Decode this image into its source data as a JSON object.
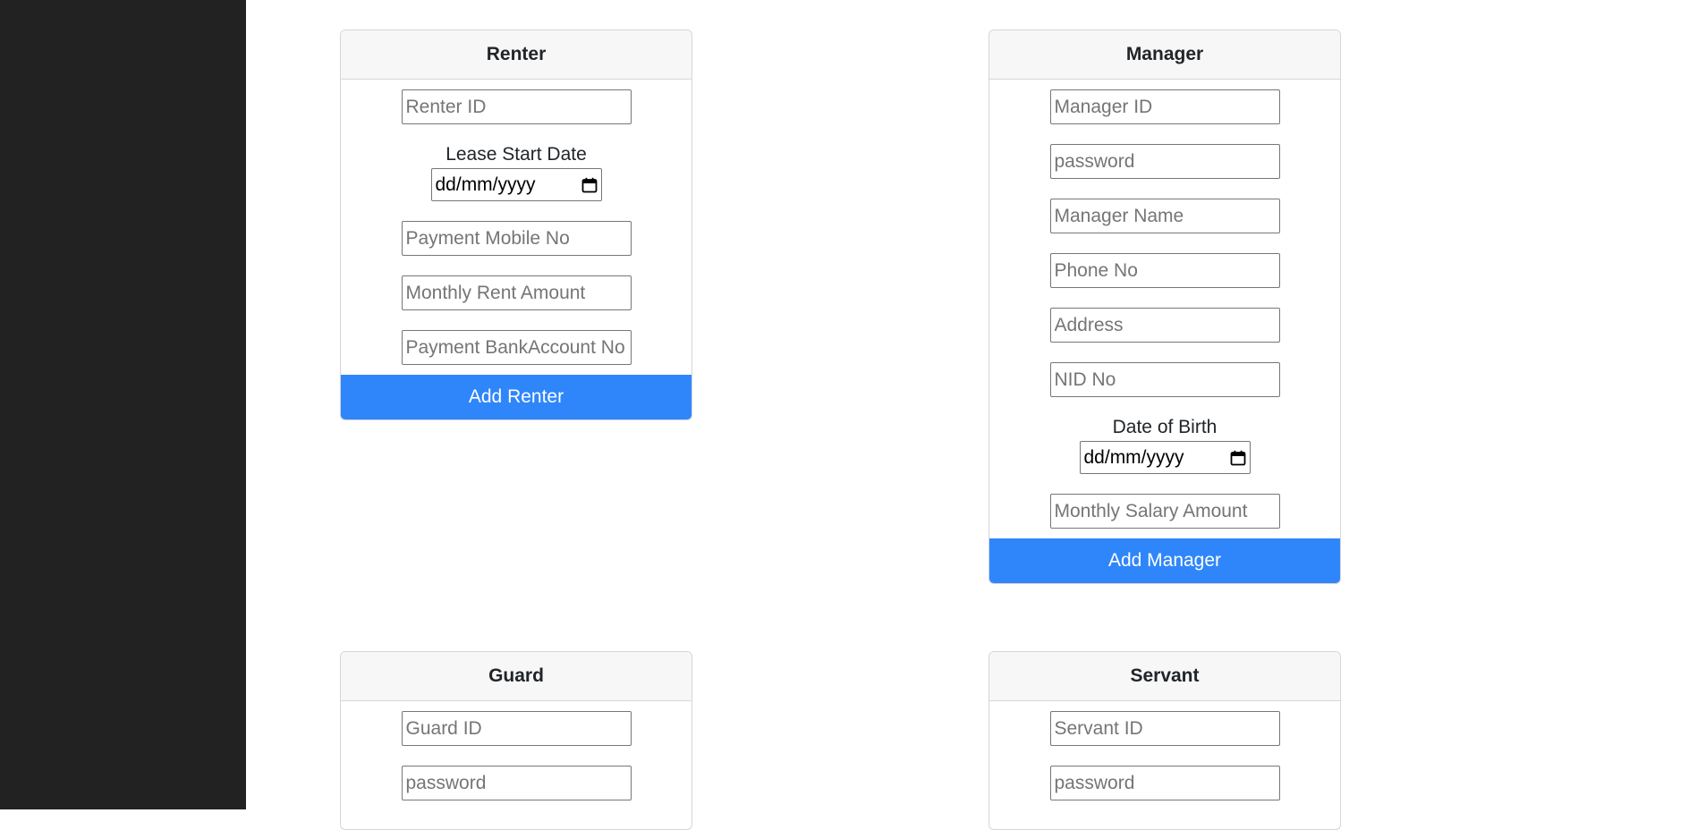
{
  "renter": {
    "title": "Renter",
    "renter_id_placeholder": "Renter ID",
    "lease_start_label": "Lease Start Date",
    "lease_start_value": "dd/mm/yyyy",
    "payment_mobile_placeholder": "Payment Mobile No",
    "monthly_rent_placeholder": "Monthly Rent Amount",
    "payment_bank_placeholder": "Payment BankAccount No",
    "button": "Add Renter"
  },
  "manager": {
    "title": "Manager",
    "manager_id_placeholder": "Manager ID",
    "password_placeholder": "password",
    "name_placeholder": "Manager Name",
    "phone_placeholder": "Phone No",
    "address_placeholder": "Address",
    "nid_placeholder": "NID No",
    "dob_label": "Date of Birth",
    "dob_value": "dd/mm/yyyy",
    "salary_placeholder": "Monthly Salary Amount",
    "button": "Add Manager"
  },
  "guard": {
    "title": "Guard",
    "guard_id_placeholder": "Guard ID",
    "password_placeholder": "password"
  },
  "servant": {
    "title": "Servant",
    "servant_id_placeholder": "Servant ID",
    "password_placeholder": "password"
  },
  "colors": {
    "sidebar": "#222222",
    "primary_button": "#2f86fa",
    "card_header": "#f7f7f7"
  },
  "icons": [
    "calendar-icon"
  ]
}
